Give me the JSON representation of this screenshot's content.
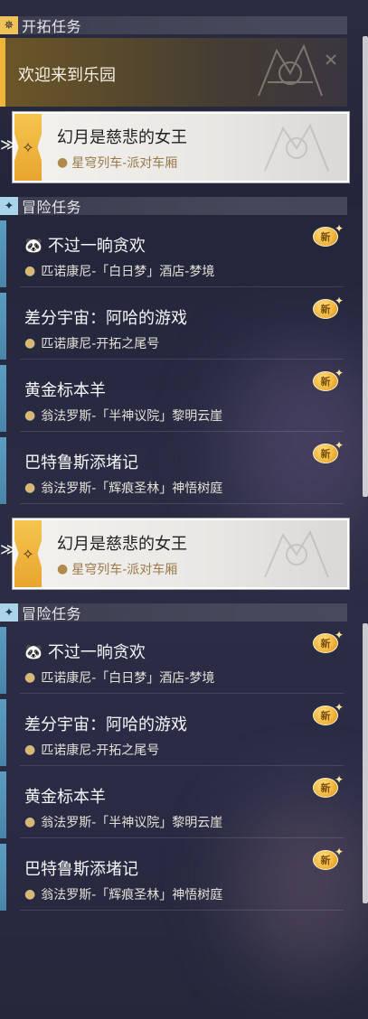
{
  "trailblaze": {
    "section_title": "开拓任务",
    "welcome_title": "欢迎来到乐园",
    "active_quest": {
      "title": "幻月是慈悲的女王",
      "location": "星穹列车-派对车厢"
    }
  },
  "adventure": {
    "section_title": "冒险任务",
    "quests": [
      {
        "title": "不过一晌贪欢",
        "location": "匹诺康尼-「白日梦」酒店-梦境",
        "badge": "新"
      },
      {
        "title": "差分宇宙：阿哈的游戏",
        "location": "匹诺康尼-开拓之尾号",
        "badge": "新"
      },
      {
        "title": "黄金标本羊",
        "location": "翁法罗斯-「半神议院」黎明云崖",
        "badge": "新"
      },
      {
        "title": "巴特鲁斯添堵记",
        "location": "翁法罗斯-「辉痕圣林」神悟树庭",
        "badge": "新"
      }
    ]
  },
  "colors": {
    "gold_accent": "#efb43a",
    "blue_accent": "#5a9dc0",
    "location_text_active": "#9a7a4a"
  },
  "icons": {
    "trailblaze_section": "compass-star-icon",
    "adventure_section": "diamond-star-icon",
    "location": "map-pin-icon",
    "new_badge": "new-badge-icon",
    "first_adventure_quest": "panda-icon"
  }
}
